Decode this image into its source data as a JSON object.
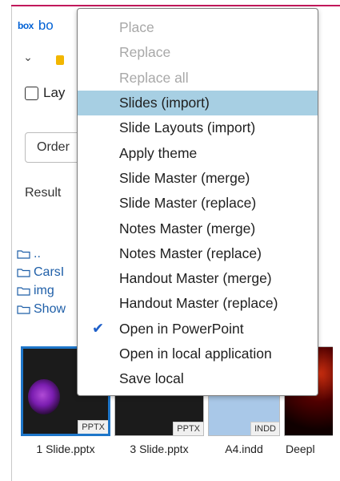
{
  "header": {
    "logo": "box",
    "title_partial": "bo"
  },
  "options": {
    "layout_checkbox_label": "Lay",
    "layout_checked": false
  },
  "sort_select": {
    "value_partial": "Order"
  },
  "results_label_partial": "Result",
  "folders": [
    {
      "label": ".."
    },
    {
      "label": "CarsI"
    },
    {
      "label": "img"
    },
    {
      "label": "Show"
    }
  ],
  "thumbnails": [
    {
      "name": "1 Slide.pptx",
      "badge": "PPTX",
      "selected": true
    },
    {
      "name": "3 Slide.pptx",
      "badge": "PPTX",
      "selected": false
    },
    {
      "name": "A4.indd",
      "badge": "INDD",
      "selected": false
    },
    {
      "name": "Deepl",
      "badge": "",
      "selected": false
    }
  ],
  "context_menu": {
    "items": [
      {
        "label": "Place",
        "state": "disabled"
      },
      {
        "label": "Replace",
        "state": "disabled"
      },
      {
        "label": "Replace all",
        "state": "disabled"
      },
      {
        "label": "Slides (import)",
        "state": "highlighted"
      },
      {
        "label": "Slide Layouts (import)",
        "state": "normal"
      },
      {
        "label": "Apply theme",
        "state": "normal"
      },
      {
        "label": "Slide Master (merge)",
        "state": "normal"
      },
      {
        "label": "Slide Master (replace)",
        "state": "normal"
      },
      {
        "label": "Notes Master (merge)",
        "state": "normal"
      },
      {
        "label": "Notes Master (replace)",
        "state": "normal"
      },
      {
        "label": "Handout Master (merge)",
        "state": "normal"
      },
      {
        "label": "Handout Master (replace)",
        "state": "normal"
      },
      {
        "label": "Open in PowerPoint",
        "state": "checked"
      },
      {
        "label": "Open in local application",
        "state": "normal"
      },
      {
        "label": "Save local",
        "state": "normal"
      }
    ]
  },
  "colors": {
    "accent": "#c2185b",
    "link": "#1f5fa8",
    "highlight": "#a7cfe3",
    "check": "#1e5fc9",
    "disabled_text": "#a8a8a8"
  }
}
